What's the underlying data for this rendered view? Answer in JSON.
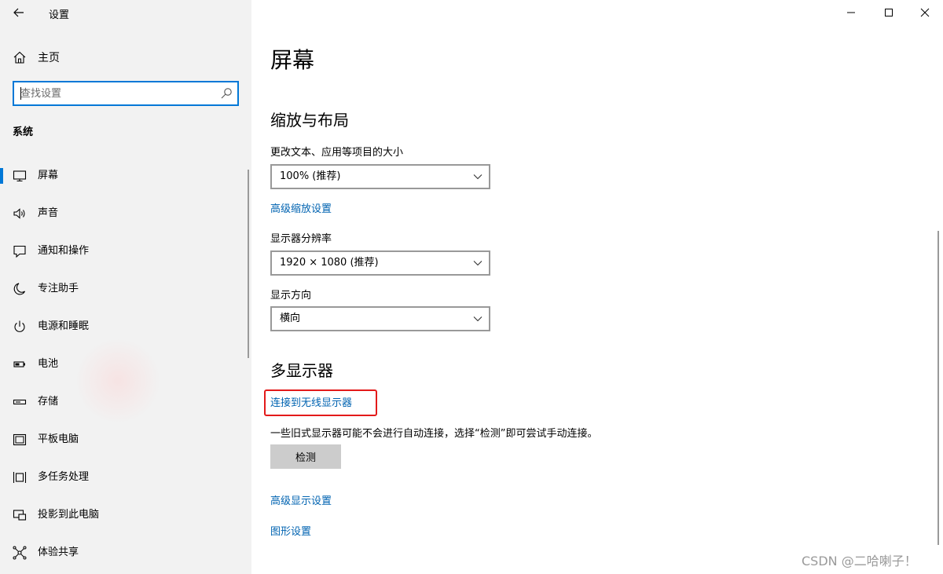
{
  "window": {
    "title": "设置",
    "controls": {
      "minimize": "minimize-icon",
      "maximize": "maximize-icon",
      "close": "close-icon"
    }
  },
  "sidebar": {
    "home_label": "主页",
    "search_placeholder": "查找设置",
    "section_label": "系统",
    "items": [
      {
        "label": "屏幕",
        "icon": "monitor-icon",
        "active": true
      },
      {
        "label": "声音",
        "icon": "speaker-icon"
      },
      {
        "label": "通知和操作",
        "icon": "notification-icon"
      },
      {
        "label": "专注助手",
        "icon": "moon-icon"
      },
      {
        "label": "电源和睡眠",
        "icon": "power-icon"
      },
      {
        "label": "电池",
        "icon": "battery-icon"
      },
      {
        "label": "存储",
        "icon": "storage-icon"
      },
      {
        "label": "平板电脑",
        "icon": "tablet-icon"
      },
      {
        "label": "多任务处理",
        "icon": "multitasking-icon"
      },
      {
        "label": "投影到此电脑",
        "icon": "project-icon"
      },
      {
        "label": "体验共享",
        "icon": "shared-experiences-icon"
      }
    ]
  },
  "main": {
    "page_title": "屏幕",
    "scale_section": {
      "heading": "缩放与布局",
      "scale_label": "更改文本、应用等项目的大小",
      "scale_value": "100% (推荐)",
      "advanced_scaling_link": "高级缩放设置",
      "resolution_label": "显示器分辨率",
      "resolution_value": "1920 × 1080 (推荐)",
      "orientation_label": "显示方向",
      "orientation_value": "横向"
    },
    "multi_display": {
      "heading": "多显示器",
      "connect_link": "连接到无线显示器",
      "description": "一些旧式显示器可能不会进行自动连接，选择“检测”即可尝试手动连接。",
      "detect_button": "检测"
    },
    "advanced_display_link": "高级显示设置",
    "graphics_link": "图形设置"
  },
  "watermark": "CSDN @二哈喇子！",
  "colors": {
    "accent": "#0078d7",
    "link": "#0063b1",
    "highlight": "#e31a1a",
    "sidebar_bg": "#f2f2f2"
  }
}
